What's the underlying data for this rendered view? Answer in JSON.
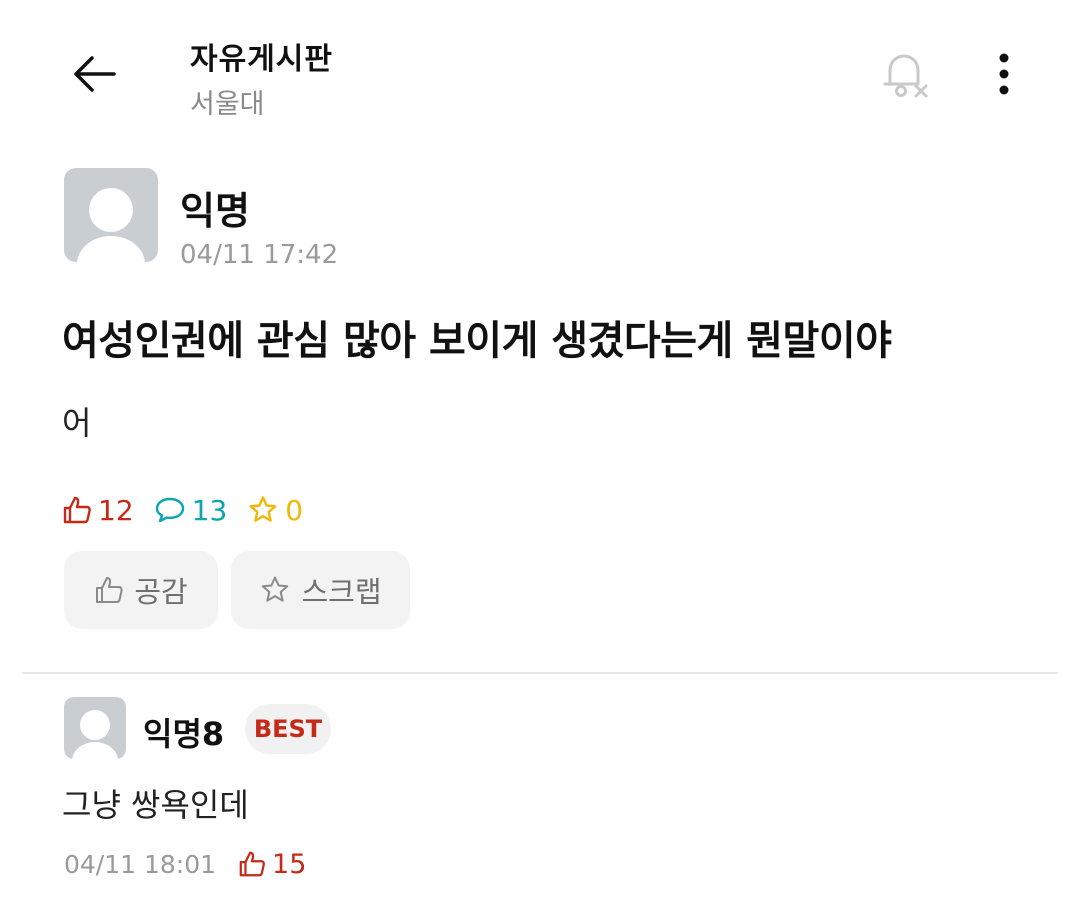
{
  "header": {
    "title": "자유게시판",
    "subtitle": "서울대",
    "back_icon": "arrow-left-icon",
    "bell_icon": "bell-off-icon",
    "more_icon": "more-vertical-icon"
  },
  "post": {
    "author": "익명",
    "time": "04/11 17:42",
    "title": "여성인권에 관심 많아 보이게 생겼다는게 뭔말이야",
    "body": "어",
    "stats": {
      "likes": "12",
      "comments": "13",
      "scraps": "0"
    },
    "actions": {
      "like_label": "공감",
      "scrap_label": "스크랩"
    }
  },
  "comments": [
    {
      "author": "익명8",
      "badge": "BEST",
      "body": "그냥 쌍욕인데",
      "time": "04/11 18:01",
      "likes": "15"
    }
  ],
  "colors": {
    "like": "#c62917",
    "comment": "#0ca5b0",
    "scrap": "#f2b705",
    "muted": "#9a9a9a",
    "button_bg": "#f3f3f3"
  }
}
